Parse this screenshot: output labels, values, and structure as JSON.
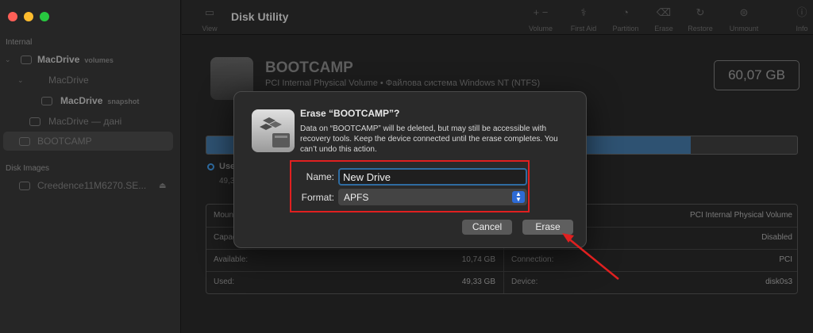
{
  "window": {
    "traffic_lights": {
      "close": "#fe5f57",
      "minimize": "#febc2e",
      "zoom": "#28c840"
    }
  },
  "sidebar": {
    "section_internal": "Internal",
    "section_disk_images": "Disk Images",
    "items": [
      {
        "label": "MacDrive",
        "sub": "volumes"
      },
      {
        "label": "MacDrive",
        "sub": ""
      },
      {
        "label": "MacDrive",
        "sub": "snapshot"
      },
      {
        "label": "MacDrive — дані",
        "sub": ""
      },
      {
        "label": "BOOTCAMP",
        "sub": ""
      },
      {
        "label": "Creedence11M6270.SE...",
        "sub": ""
      }
    ]
  },
  "toolbar": {
    "view_label": "View",
    "title": "Disk Utility",
    "add_remove": "+ −",
    "volume_label": "Volume",
    "first_aid_label": "First Aid",
    "partition_label": "Partition",
    "erase_label": "Erase",
    "restore_label": "Restore",
    "unmount_label": "Unmount",
    "info_label": "Info"
  },
  "volume": {
    "name": "BOOTCAMP",
    "subtitle": "PCI Internal Physical Volume • Файлова система Windows NT (NTFS)",
    "size": "60,07 GB",
    "used_fraction": 0.82,
    "legend_label": "Used",
    "legend_value": "49,33 GB"
  },
  "info_table": {
    "left": [
      {
        "label": "Mount Point:",
        "value": ""
      },
      {
        "label": "Capacity:",
        "value": ""
      },
      {
        "label": "Available:",
        "value": "10,74 GB"
      },
      {
        "label": "Used:",
        "value": "49,33 GB"
      }
    ],
    "right": [
      {
        "label": "",
        "value": "PCI Internal Physical Volume"
      },
      {
        "label": "",
        "value": "Disabled"
      },
      {
        "label": "Connection:",
        "value": "PCI"
      },
      {
        "label": "Device:",
        "value": "disk0s3"
      }
    ]
  },
  "dialog": {
    "title": "Erase “BOOTCAMP”?",
    "message": "Data on “BOOTCAMP” will be deleted, but may still be accessible with recovery tools. Keep the device connected until the erase completes. You can’t undo this action.",
    "name_label": "Name:",
    "name_value": "New Drive",
    "format_label": "Format:",
    "format_value": "APFS",
    "cancel_label": "Cancel",
    "erase_label": "Erase"
  },
  "annotation": {
    "color": "#e02020"
  }
}
